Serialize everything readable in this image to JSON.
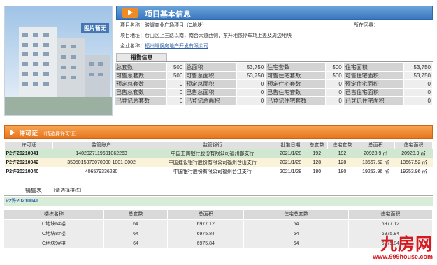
{
  "photo": {
    "no_picture": "图片暂无"
  },
  "project": {
    "section_title": "项目基本信息",
    "name_label": "项目名称：",
    "name": "骏耀商业广场项目（C地块）",
    "address_label": "项目地址：",
    "address": "仓山区上三路以南，南台大道西侧，东升地铁停车场上盖及周边地块",
    "developer_label": "企业名称：",
    "developer": "福州耀俣房地产开发有限公司",
    "district_label": "所在区县："
  },
  "sales_info": {
    "tab": "销售信息",
    "rows": [
      [
        {
          "l": "总套数",
          "v": "500"
        },
        {
          "l": "总面积",
          "v": "53,750"
        },
        {
          "l": "住宅套数",
          "v": "500"
        },
        {
          "l": "住宅面积",
          "v": "53,750"
        }
      ],
      [
        {
          "l": "可售总套数",
          "v": "500"
        },
        {
          "l": "可售总面积",
          "v": "53,750"
        },
        {
          "l": "可售住宅套数",
          "v": "500"
        },
        {
          "l": "可售住宅面积",
          "v": "53,750"
        }
      ],
      [
        {
          "l": "预定总套数",
          "v": "0"
        },
        {
          "l": "预定总面积",
          "v": "0"
        },
        {
          "l": "预定住宅套数",
          "v": "0"
        },
        {
          "l": "预定住宅面积",
          "v": "0"
        }
      ],
      [
        {
          "l": "已售总套数",
          "v": "0"
        },
        {
          "l": "已售总面积",
          "v": "0"
        },
        {
          "l": "已售住宅套数",
          "v": "0"
        },
        {
          "l": "已售住宅面积",
          "v": "0"
        }
      ],
      [
        {
          "l": "已登记总套数",
          "v": "0"
        },
        {
          "l": "已登记总面积",
          "v": "0"
        },
        {
          "l": "已登记住宅套数",
          "v": "0"
        },
        {
          "l": "已登记住宅面积",
          "v": "0"
        }
      ]
    ]
  },
  "permit": {
    "title": "许可证",
    "subtitle": "（请选择许可证）",
    "headers": [
      "许可证",
      "监管账户",
      "监管银行",
      "批准日期",
      "总套数",
      "住宅套数",
      "总面积",
      "住宅面积"
    ],
    "rows": [
      [
        "P2许20210041",
        "1402027119601062263",
        "中国工商银行股份有限公司福州鄙支行",
        "2021/1/28",
        "192",
        "192",
        "20928.9 ㎡",
        "20928.9 ㎡"
      ],
      [
        "P2许20210042",
        "3505015873070000 1801-3002",
        "中国建设银行股份有限公司福州仓山支行",
        "2021/1/28",
        "128",
        "128",
        "13567.52 ㎡",
        "13567.52 ㎡"
      ],
      [
        "P2许20210040",
        "406579336280",
        "中国银行股份有限公司福州台江支行",
        "2021/1/28",
        "180",
        "180",
        "19253.96 ㎡",
        "19253.96 ㎡"
      ]
    ]
  },
  "sales_table": {
    "tab": "销售表",
    "subtitle": "（请选择楼栋）",
    "selected": "P2许20210041",
    "headers": [
      "楼栋名称",
      "总套数",
      "总面积",
      "住宅总套数",
      "住宅面积"
    ],
    "rows": [
      [
        "C地块6#楼",
        "64",
        "6977.12",
        "64",
        "6977.12"
      ],
      [
        "C地块8#楼",
        "64",
        "6975.84",
        "64",
        "6975.84"
      ],
      [
        "C地块9#楼",
        "64",
        "6975.84",
        "64",
        "6975.84"
      ]
    ]
  },
  "watermark": {
    "logo": "九房网",
    "url": "www.999house.com"
  },
  "colors": {
    "blue_header": "#3b78bf",
    "orange_header": "#e8751c",
    "green_row": "#cfe8cf",
    "brand_red": "#d71920"
  }
}
